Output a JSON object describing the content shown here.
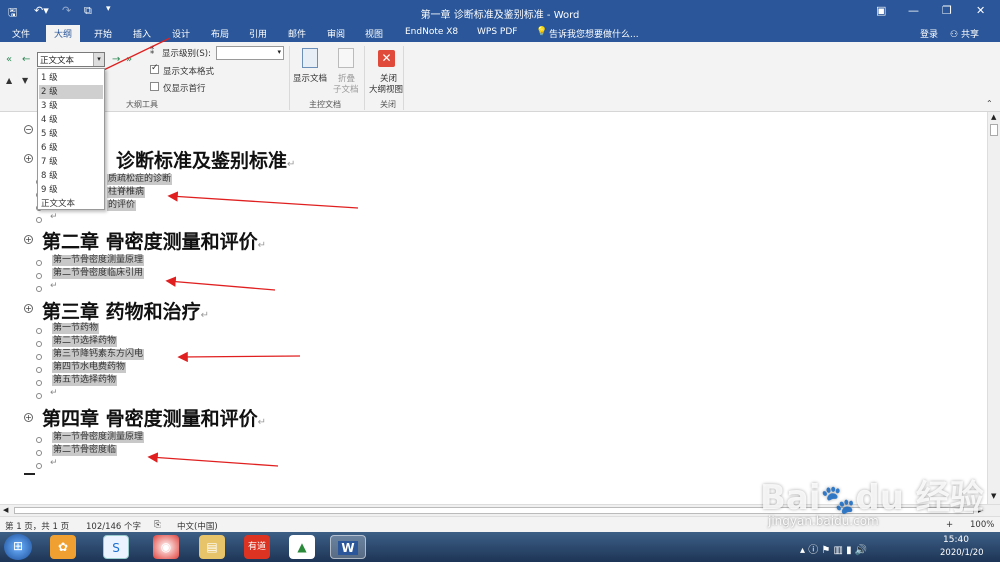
{
  "window": {
    "title": "第一章 诊断标准及鉴别标准 - Word",
    "login": "登录",
    "share": "共享"
  },
  "tabs": [
    "文件",
    "大纲",
    "开始",
    "插入",
    "设计",
    "布局",
    "引用",
    "邮件",
    "审阅",
    "视图",
    "EndNote X8",
    "WPS PDF"
  ],
  "tell_me": "告诉我您想要做什么...",
  "ribbon": {
    "level_value": "正文文本",
    "show_level_label": "显示级别(S):",
    "show_text_format": "显示文本格式",
    "show_first_line": "仅显示首行",
    "outline_tools_label": "大纲工具",
    "show_document": "显示文档",
    "collapse_sub_1": "折叠",
    "collapse_sub_2": "子文档",
    "master_doc_label": "主控文档",
    "close_1": "关闭",
    "close_2": "大纲视图",
    "close_group_label": "关闭",
    "show_text_format_checked": true,
    "show_first_line_checked": false
  },
  "level_options": [
    "1 级",
    "2 级",
    "3 级",
    "4 级",
    "5 级",
    "6 级",
    "7 级",
    "8 级",
    "9 级",
    "正文文本"
  ],
  "level_selected_index": 1,
  "document": {
    "ch1_title": "诊断标准及鉴别标准",
    "ch1_items": [
      "质疏松症的诊断",
      "柱脊椎病",
      "的评价"
    ],
    "ch2_title": "第二章  骨密度测量和评价",
    "ch2_items": [
      "第一节骨密度测量原理",
      "第二节骨密度临床引用"
    ],
    "ch3_title": "第三章  药物和治疗",
    "ch3_items": [
      "第一节药物",
      "第二节选择药物",
      "第三节降钙素东方闪电",
      "第四节水电费药物",
      "第五节选择药物"
    ],
    "ch4_title": "第四章  骨密度测量和评价",
    "ch4_items": [
      "第一节骨密度测量原理",
      "第二节骨密度临"
    ],
    "para_mark": "↵"
  },
  "status": {
    "page": "第 1 页，共 1 页",
    "words": "102/146 个字",
    "lang": "中文(中国)",
    "zoom": "100%"
  },
  "taskbar": {
    "time": "15:40",
    "date": "2020/1/20"
  },
  "watermark": {
    "text": "Bai du 经验",
    "url": "jingyan.baidu.com"
  },
  "colors": {
    "word_blue": "#2b579a",
    "arrow_red": "#e02020",
    "highlight": "#c8c8c8"
  }
}
